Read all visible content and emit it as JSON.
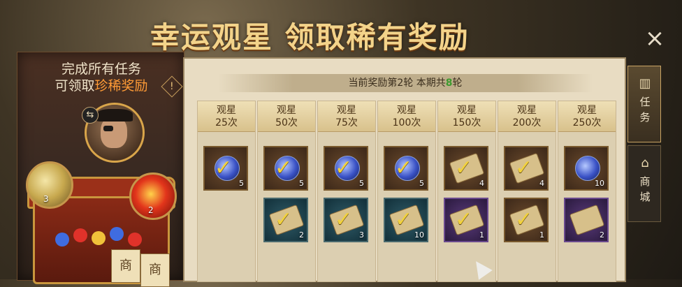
{
  "title": "幸运观星 领取稀有奖励",
  "close_label": "×",
  "left_panel": {
    "line1": "完成所有任务",
    "line2_prefix": "可领取",
    "line2_highlight": "珍稀奖励",
    "warn_glyph": "!",
    "swap_glyph": "⇆",
    "gold_orb_count": "3",
    "red_orb_count": "2",
    "tag1": "商",
    "tag2": "商"
  },
  "round_info": {
    "prefix": "当前奖励第2轮  本期共",
    "total": "8",
    "suffix": "轮"
  },
  "milestones": [
    {
      "label": "观星",
      "count": "25次",
      "rewards": [
        {
          "type": "orb",
          "bg": "brown",
          "qty": "5",
          "checked": true
        }
      ]
    },
    {
      "label": "观星",
      "count": "50次",
      "rewards": [
        {
          "type": "orb",
          "bg": "brown",
          "qty": "5",
          "checked": true
        },
        {
          "type": "scroll",
          "bg": "teal",
          "qty": "2",
          "checked": true
        }
      ]
    },
    {
      "label": "观星",
      "count": "75次",
      "rewards": [
        {
          "type": "orb",
          "bg": "brown",
          "qty": "5",
          "checked": true
        },
        {
          "type": "scroll",
          "bg": "teal",
          "qty": "3",
          "checked": true
        }
      ]
    },
    {
      "label": "观星",
      "count": "100次",
      "rewards": [
        {
          "type": "orb",
          "bg": "brown",
          "qty": "5",
          "checked": true
        },
        {
          "type": "scroll",
          "bg": "teal",
          "qty": "10",
          "checked": true
        }
      ]
    },
    {
      "label": "观星",
      "count": "150次",
      "rewards": [
        {
          "type": "scroll",
          "bg": "brown",
          "qty": "4",
          "checked": true
        },
        {
          "type": "scroll",
          "bg": "purple",
          "qty": "1",
          "checked": true
        }
      ]
    },
    {
      "label": "观星",
      "count": "200次",
      "rewards": [
        {
          "type": "scroll",
          "bg": "brown",
          "qty": "4",
          "checked": true
        },
        {
          "type": "box",
          "bg": "brown",
          "qty": "1",
          "checked": true
        }
      ]
    },
    {
      "label": "观星",
      "count": "250次",
      "rewards": [
        {
          "type": "orb",
          "bg": "brown",
          "qty": "10",
          "checked": false
        },
        {
          "type": "scroll",
          "bg": "purple",
          "qty": "2",
          "checked": false
        }
      ]
    }
  ],
  "tabs": [
    {
      "label_top": "任",
      "label_bottom": "务",
      "icon": "task-icon",
      "glyph": "▥"
    },
    {
      "label_top": "商",
      "label_bottom": "城",
      "icon": "shop-icon",
      "glyph": "⌂"
    }
  ]
}
